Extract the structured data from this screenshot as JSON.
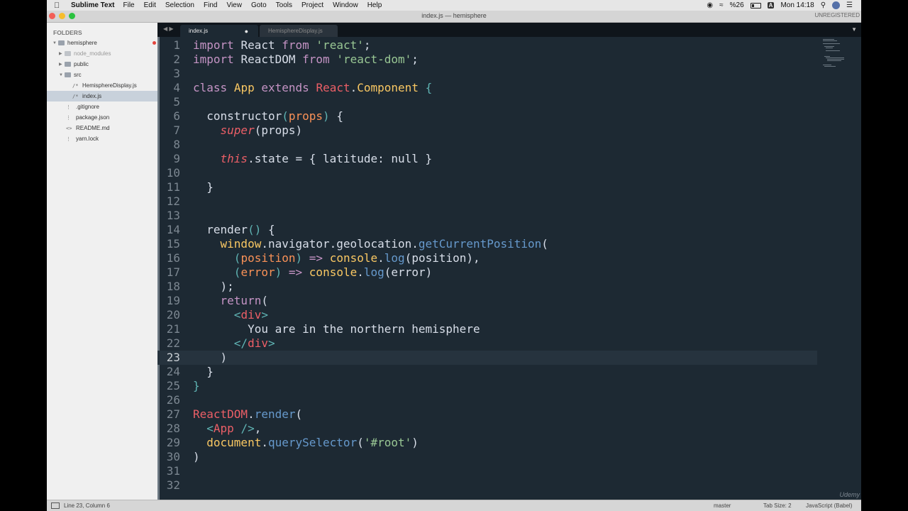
{
  "menubar": {
    "app": "Sublime Text",
    "items": [
      "File",
      "Edit",
      "Selection",
      "Find",
      "View",
      "Goto",
      "Tools",
      "Project",
      "Window",
      "Help"
    ],
    "battery": "%26",
    "input_source": "A",
    "clock": "Mon 14:18"
  },
  "titlebar": {
    "title": "index.js — hemisphere",
    "unregistered": "UNREGISTERED"
  },
  "sidebar": {
    "header": "FOLDERS",
    "items": [
      {
        "label": "hemisphere",
        "indicator": "red"
      },
      {
        "label": "node_modules"
      },
      {
        "label": "public",
        "indicator": "blue"
      },
      {
        "label": "src",
        "indicator": "red"
      },
      {
        "label": "HemisphereDisplay.js",
        "indicator": "hollow"
      },
      {
        "label": "index.js",
        "indicator": "blue"
      },
      {
        "label": ".gitignore"
      },
      {
        "label": "package.json"
      },
      {
        "label": "README.md"
      },
      {
        "label": "yarn.lock"
      }
    ]
  },
  "tabs": [
    {
      "label": "index.js",
      "active": true,
      "modified": true
    },
    {
      "label": "HemisphereDisplay.js",
      "active": false
    }
  ],
  "editor": {
    "line_numbers": [
      "1",
      "2",
      "3",
      "4",
      "5",
      "6",
      "7",
      "8",
      "9",
      "10",
      "11",
      "12",
      "13",
      "14",
      "15",
      "16",
      "17",
      "18",
      "19",
      "20",
      "21",
      "22",
      "23",
      "24",
      "25",
      "26",
      "27",
      "28",
      "29",
      "30",
      "31",
      "32"
    ],
    "code_text": {
      "import": "import",
      "React": "React",
      "from": "from",
      "react_str": "'react'",
      "semi": ";",
      "ReactDOM": "ReactDOM",
      "react_dom_str": "'react-dom'",
      "class": "class",
      "App": "App",
      "extends": "extends",
      "Component": "Component",
      "constructor": "constructor",
      "props": "props",
      "super": "super",
      "this": "this",
      "state_prefix": ".state = { latitude: ",
      "null": "null",
      "close_obj": " }",
      "render": "render",
      "window": "window",
      "navigator": ".navigator",
      "geolocation": ".geolocation",
      "getCurrentPosition": "getCurrentPosition",
      "position": "position",
      "arrow": "=>",
      "console": "console",
      "log": "log",
      "error": "error",
      "return": "return",
      "div": "div",
      "message": "You are in the northern hemisphere",
      "document": "document",
      "querySelector": "querySelector",
      "root_str": "'#root'"
    }
  },
  "statusbar": {
    "position": "Line 23, Column 6",
    "branch": "master",
    "tab_size": "Tab Size: 2",
    "syntax": "JavaScript (Babel)"
  },
  "watermark": "Udemy",
  "colors": {
    "editor_bg": "#1d2933",
    "keyword": "#ec5f67",
    "class": "#fac863",
    "string": "#99c794",
    "function": "#6699cc",
    "param": "#f99157"
  }
}
